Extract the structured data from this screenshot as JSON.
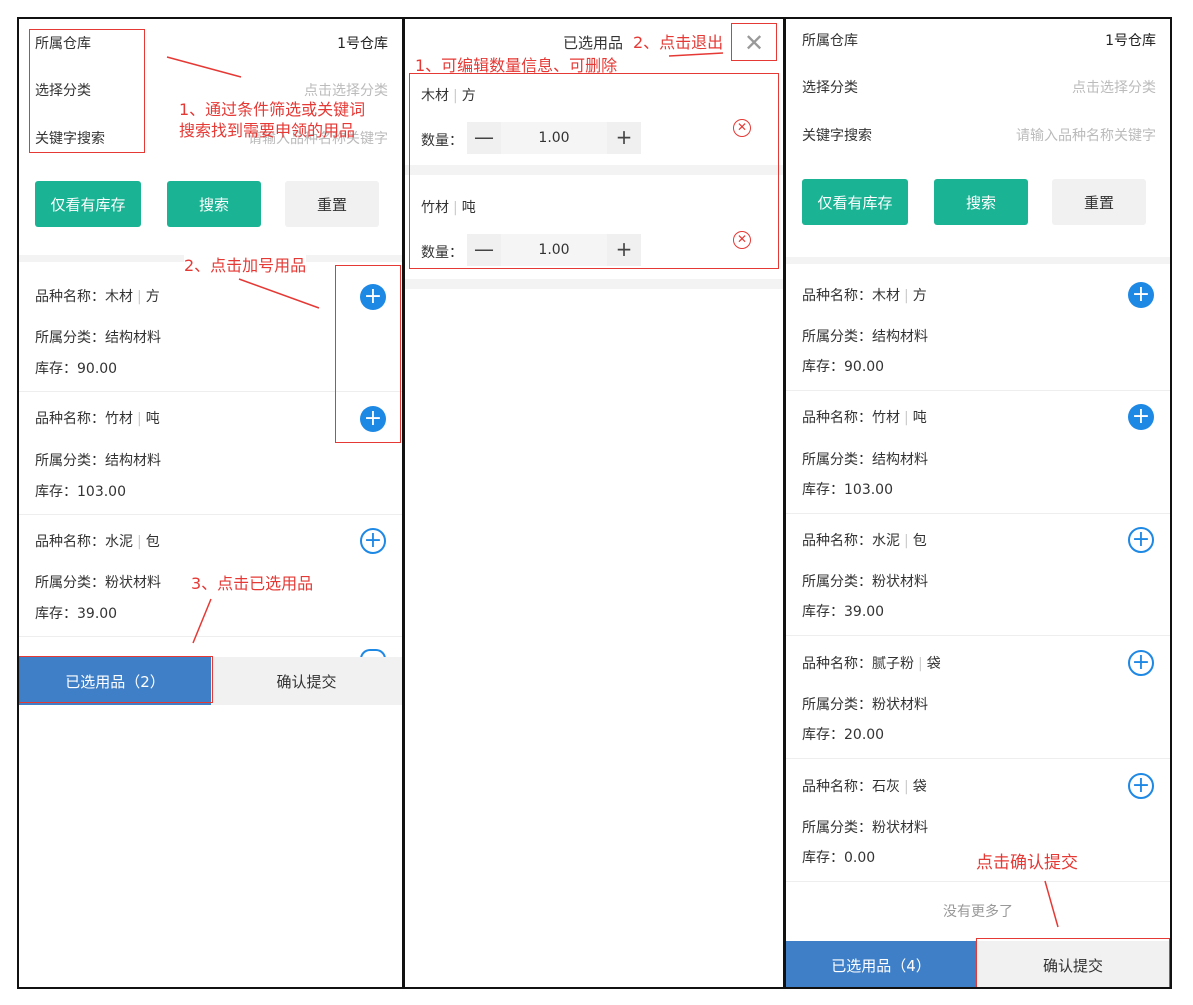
{
  "panel1": {
    "warehouse_label": "所属仓库",
    "warehouse_value": "1号仓库",
    "category_label": "选择分类",
    "category_placeholder": "点击选择分类",
    "keyword_label": "关键字搜索",
    "keyword_placeholder": "请输入品种名称关键字",
    "btn_stock": "仅看有库存",
    "btn_search": "搜索",
    "btn_reset": "重置",
    "items": [
      {
        "name_label": "品种名称：",
        "name": "木材",
        "unit": "方",
        "cat_label": "所属分类：",
        "cat": "结构材料",
        "stock_label": "库存：",
        "stock": "90.00"
      },
      {
        "name_label": "品种名称：",
        "name": "竹材",
        "unit": "吨",
        "cat_label": "所属分类：",
        "cat": "结构材料",
        "stock_label": "库存：",
        "stock": "103.00"
      },
      {
        "name_label": "品种名称：",
        "name": "水泥",
        "unit": "包",
        "cat_label": "所属分类：",
        "cat": "粉状材料",
        "stock_label": "库存：",
        "stock": "39.00"
      }
    ],
    "bottom_selected": "已选用品（2）",
    "bottom_submit": "确认提交",
    "ann1": "1、通过条件筛选或关键词",
    "ann1b": "搜索找到需要申领的用品",
    "ann2": "2、点击加号用品",
    "ann3": "3、点击已选用品"
  },
  "panel2": {
    "title": "已选用品",
    "items": [
      {
        "name": "木材",
        "unit": "方",
        "qty_label": "数量：",
        "qty": "1.00"
      },
      {
        "name": "竹材",
        "unit": "吨",
        "qty_label": "数量：",
        "qty": "1.00"
      }
    ],
    "ann1": "1、可编辑数量信息、可删除",
    "ann2": "2、点击退出"
  },
  "panel3": {
    "warehouse_label": "所属仓库",
    "warehouse_value": "1号仓库",
    "category_label": "选择分类",
    "category_placeholder": "点击选择分类",
    "keyword_label": "关键字搜索",
    "keyword_placeholder": "请输入品种名称关键字",
    "btn_stock": "仅看有库存",
    "btn_search": "搜索",
    "btn_reset": "重置",
    "items": [
      {
        "name_label": "品种名称：",
        "name": "木材",
        "unit": "方",
        "cat_label": "所属分类：",
        "cat": "结构材料",
        "stock_label": "库存：",
        "stock": "90.00"
      },
      {
        "name_label": "品种名称：",
        "name": "竹材",
        "unit": "吨",
        "cat_label": "所属分类：",
        "cat": "结构材料",
        "stock_label": "库存：",
        "stock": "103.00"
      },
      {
        "name_label": "品种名称：",
        "name": "水泥",
        "unit": "包",
        "cat_label": "所属分类：",
        "cat": "粉状材料",
        "stock_label": "库存：",
        "stock": "39.00"
      },
      {
        "name_label": "品种名称：",
        "name": "腻子粉",
        "unit": "袋",
        "cat_label": "所属分类：",
        "cat": "粉状材料",
        "stock_label": "库存：",
        "stock": "20.00"
      },
      {
        "name_label": "品种名称：",
        "name": "石灰",
        "unit": "袋",
        "cat_label": "所属分类：",
        "cat": "粉状材料",
        "stock_label": "库存：",
        "stock": "0.00"
      }
    ],
    "no_more": "没有更多了",
    "bottom_selected": "已选用品（4）",
    "bottom_submit": "确认提交",
    "ann_submit": "点击确认提交"
  },
  "colors": {
    "teal": "#1ab394",
    "blue": "#1e88e5",
    "bar_blue": "#3f7fc8",
    "annotation_red": "#e53935"
  }
}
